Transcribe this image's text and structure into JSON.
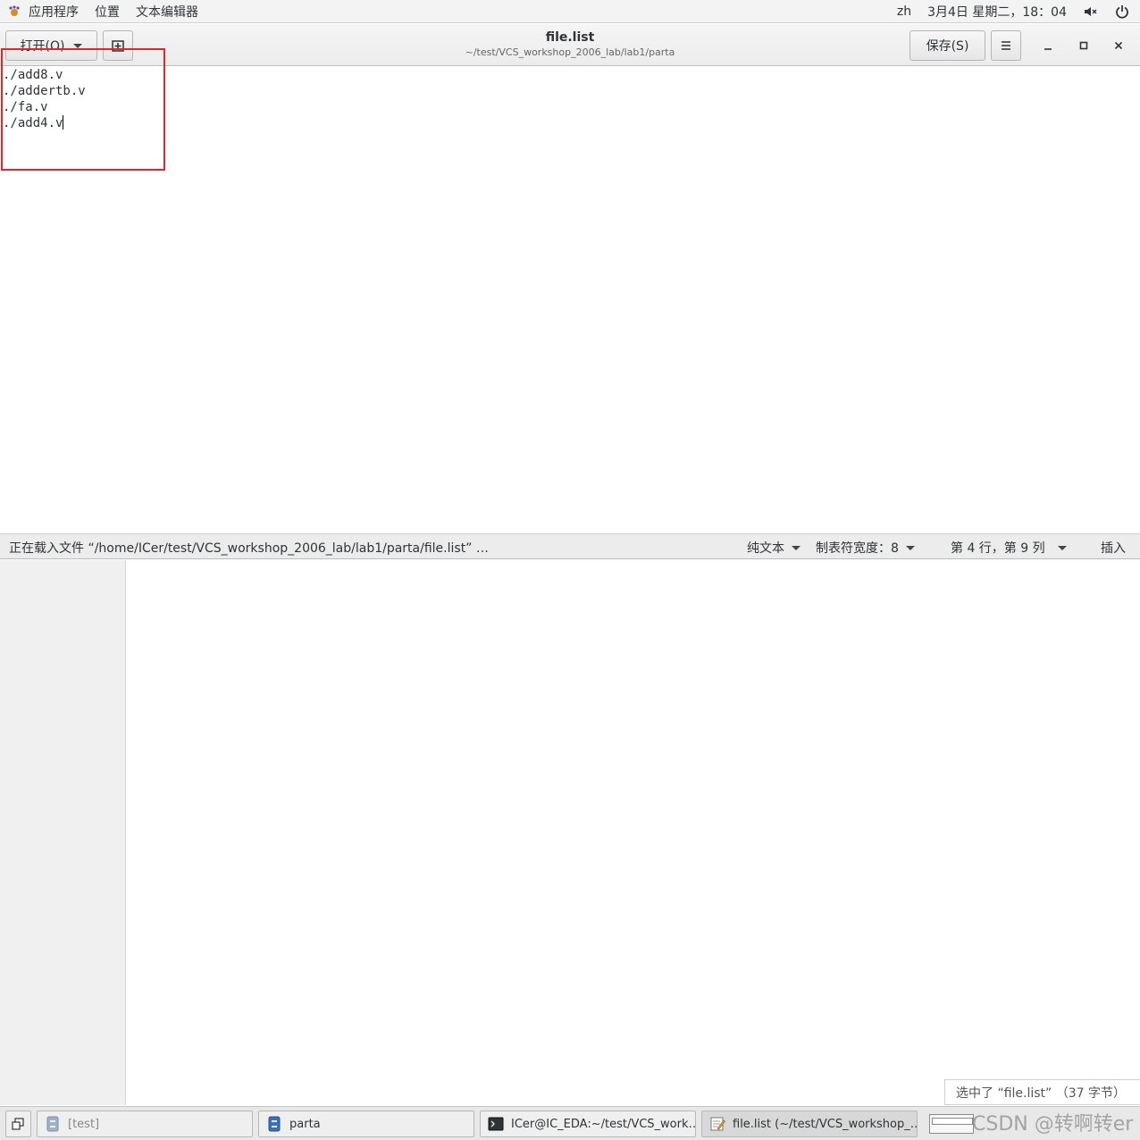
{
  "topbar": {
    "applications": "应用程序",
    "places": "位置",
    "app_name": "文本编辑器",
    "input_method": "zh",
    "datetime": "3月4日 星期二，18：04"
  },
  "header": {
    "open_label": "打开(O)",
    "title": "file.list",
    "subtitle": "~/test/VCS_workshop_2006_lab/lab1/parta",
    "save_label": "保存(S)"
  },
  "editor": {
    "lines": [
      "./add8.v",
      "./addertb.v",
      "./fa.v",
      "./add4.v"
    ]
  },
  "statusbar": {
    "message": "正在载入文件 “/home/ICer/test/VCS_workshop_2006_lab/lab1/parta/file.list” …",
    "language": "纯文本",
    "tab_width": "制表符宽度：8",
    "position": "第 4 行，第 9 列",
    "insert_mode": "插入"
  },
  "file_manager": {
    "selection_status": "选中了 “file.list” （37 字节）"
  },
  "taskbar": {
    "items": [
      "[test]",
      "parta",
      "ICer@IC_EDA:~/test/VCS_work…",
      "file.list (~/test/VCS_workshop_…"
    ]
  },
  "watermark": "CSDN @转啊转er",
  "colors": {
    "highlight_box": "#e0262b"
  }
}
